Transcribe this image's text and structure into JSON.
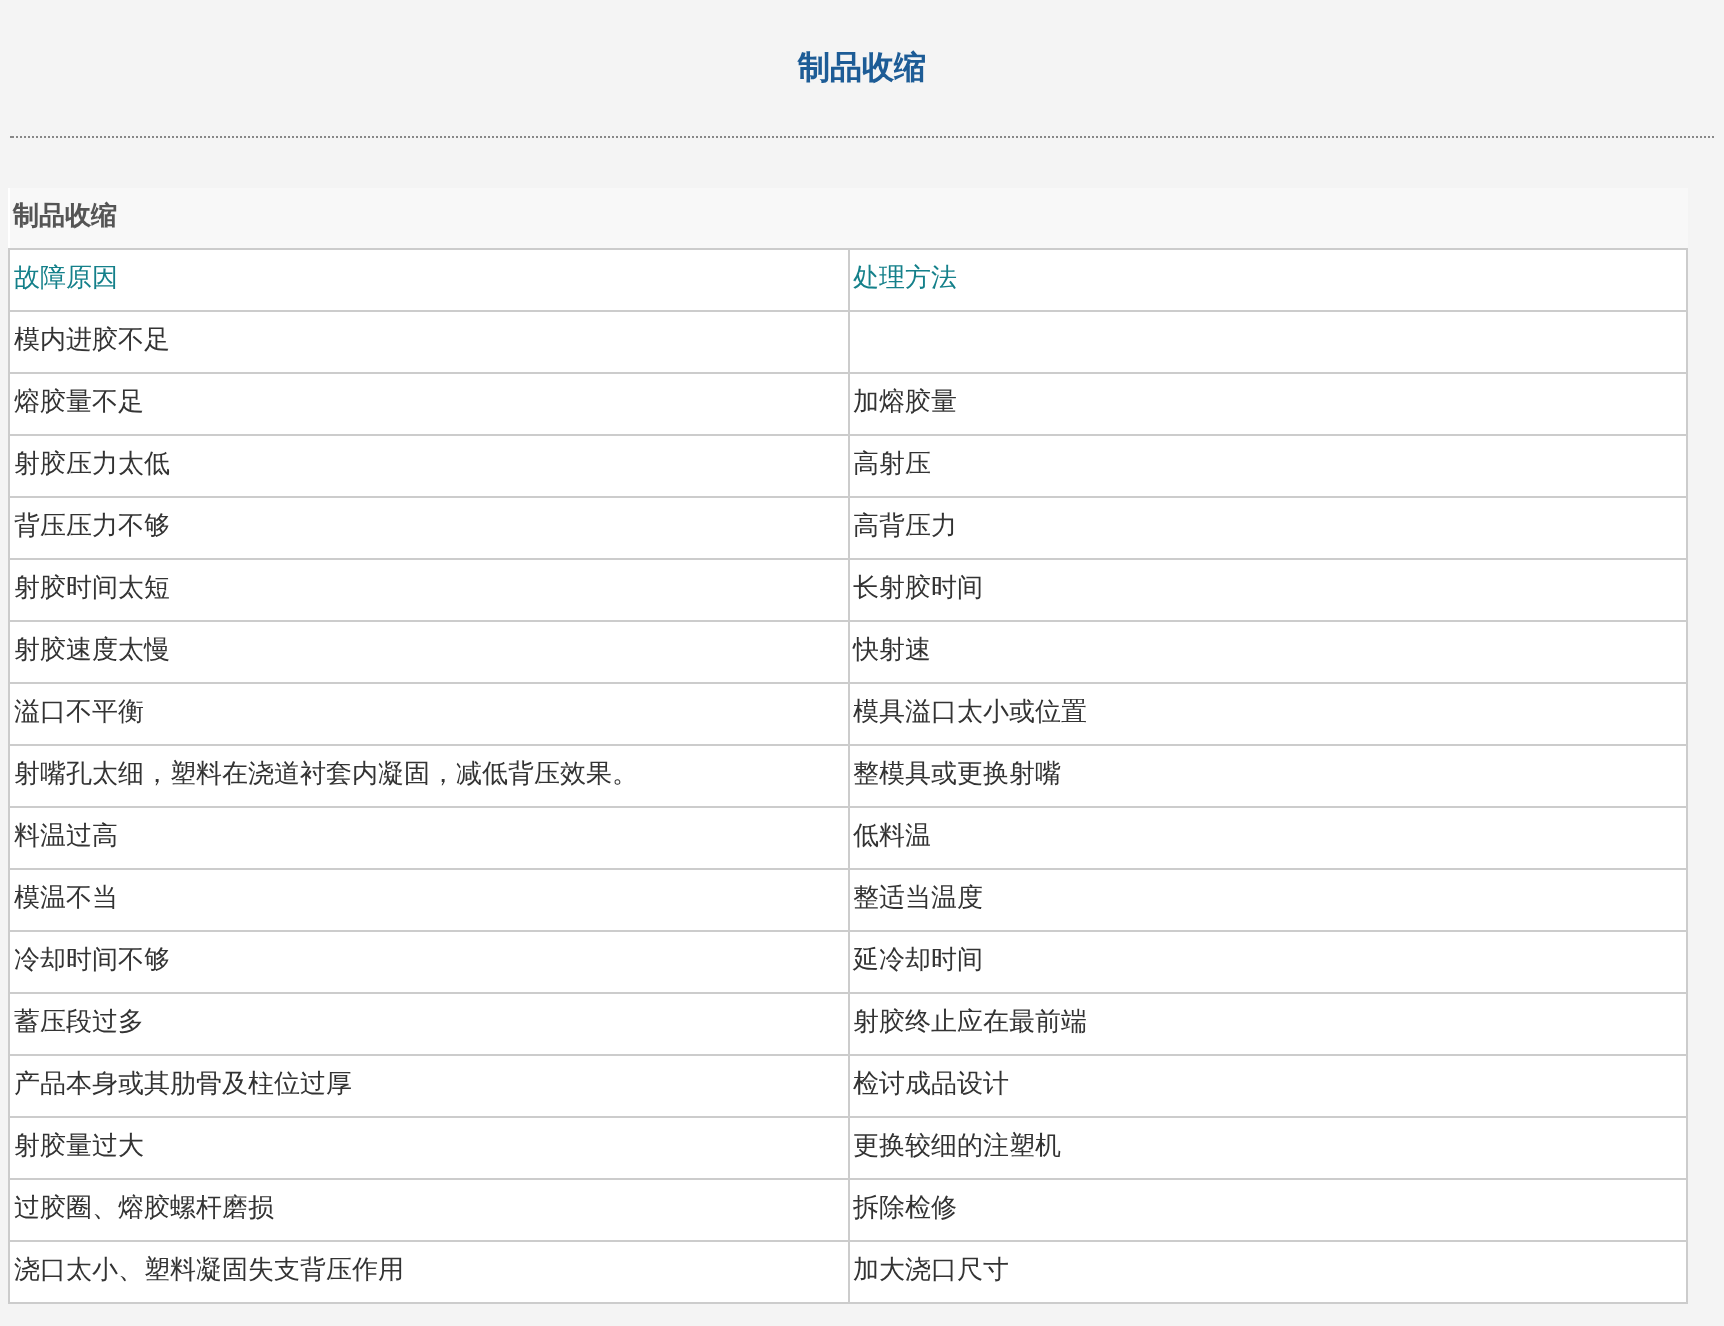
{
  "page_title": "制品收缩",
  "table": {
    "caption": "制品收缩",
    "columns": [
      "故障原因",
      "处理方法"
    ],
    "rows": [
      [
        "模内进胶不足",
        ""
      ],
      [
        "熔胶量不足",
        "加熔胶量"
      ],
      [
        "射胶压力太低",
        "高射压"
      ],
      [
        "背压压力不够",
        "高背压力"
      ],
      [
        "射胶时间太短",
        "长射胶时间"
      ],
      [
        "射胶速度太慢",
        "快射速"
      ],
      [
        "溢口不平衡",
        "模具溢口太小或位置"
      ],
      [
        "射嘴孔太细，塑料在浇道衬套内凝固，减低背压效果。",
        "整模具或更换射嘴"
      ],
      [
        "料温过高",
        "低料温"
      ],
      [
        "模温不当",
        "整适当温度"
      ],
      [
        "冷却时间不够",
        "延冷却时间"
      ],
      [
        "蓄压段过多",
        "射胶终止应在最前端"
      ],
      [
        "产品本身或其肋骨及柱位过厚",
        "检讨成品设计"
      ],
      [
        "射胶量过大",
        "更换较细的注塑机"
      ],
      [
        "过胶圈、熔胶螺杆磨损",
        "拆除检修"
      ],
      [
        "浇口太小、塑料凝固失支背压作用",
        "加大浇口尺寸"
      ]
    ]
  }
}
